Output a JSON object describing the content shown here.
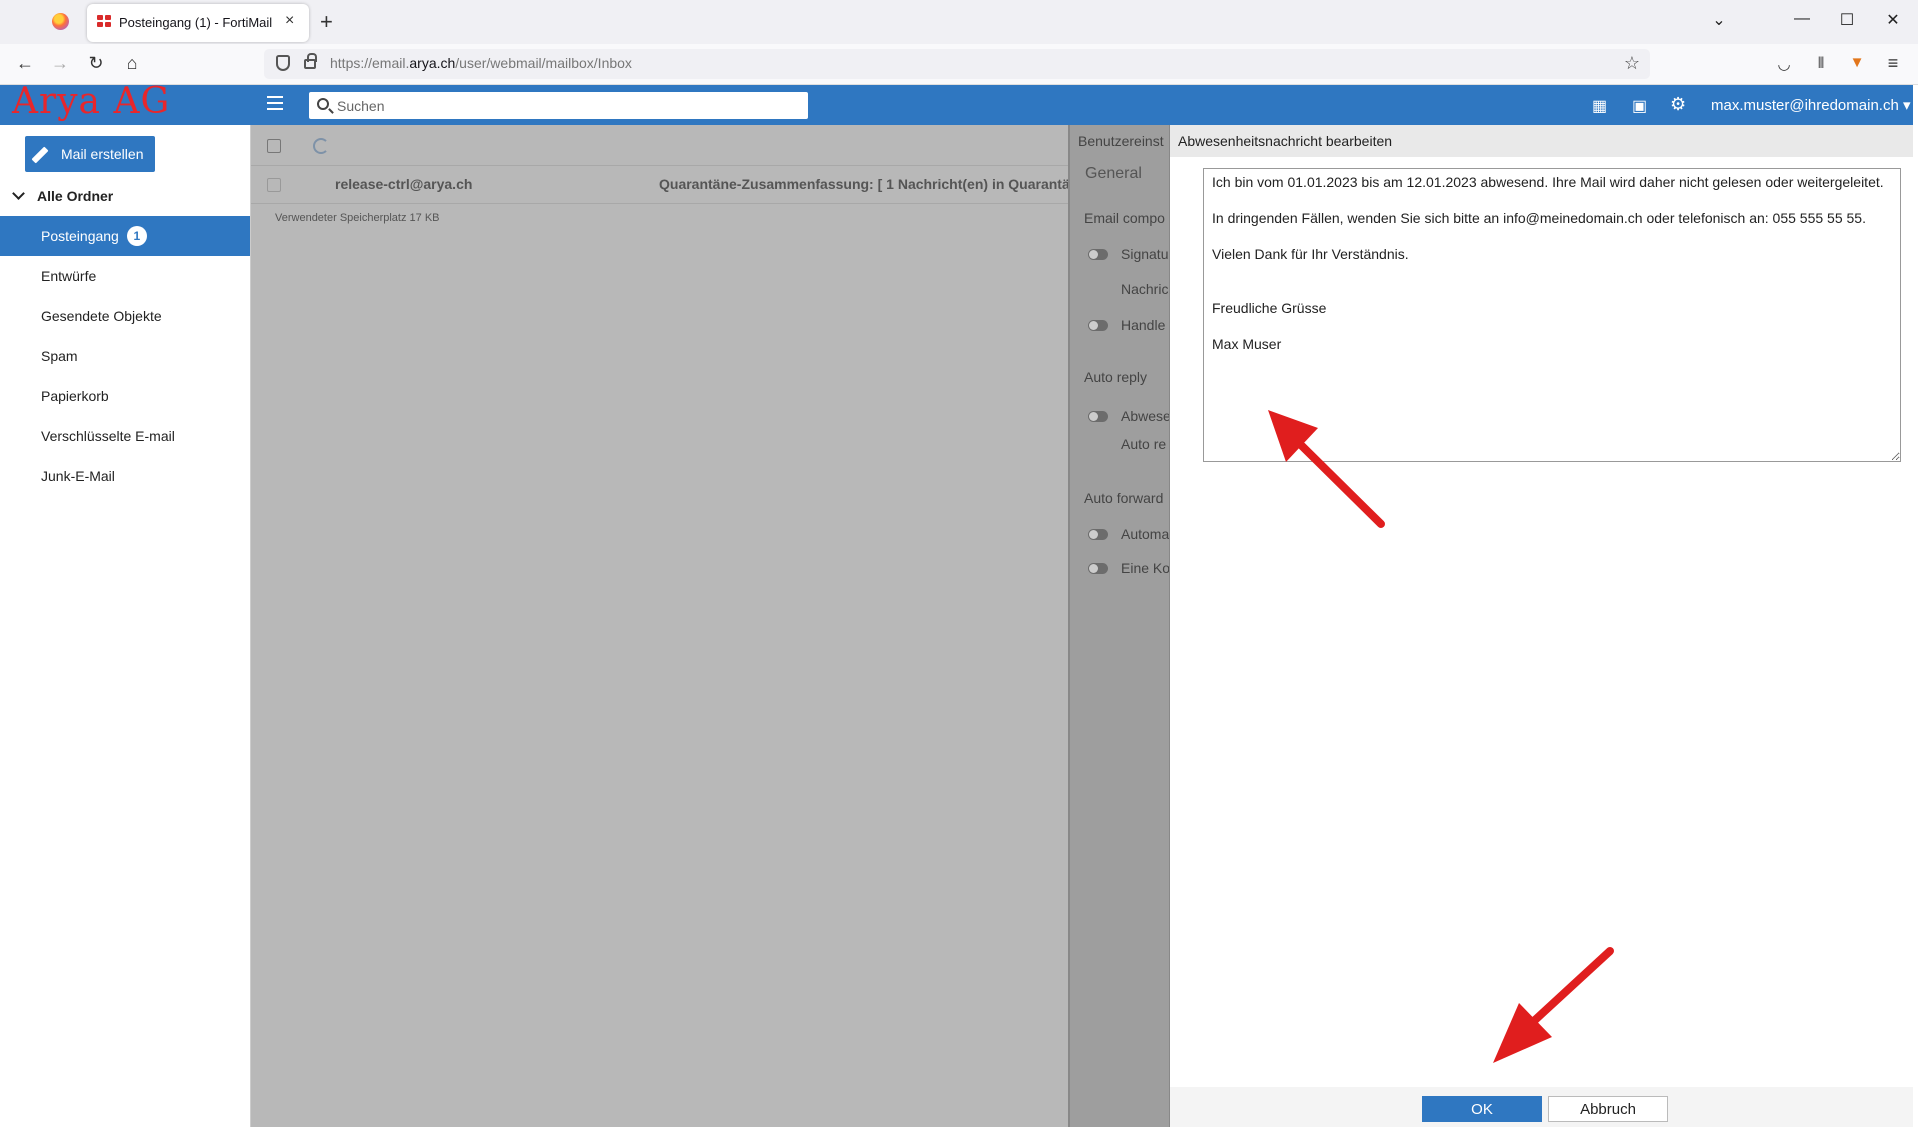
{
  "browser": {
    "tab_title": "Posteingang (1) - FortiMail",
    "tab_close": "×",
    "new_tab": "+",
    "url_prefix": "https://email.",
    "url_domain": "arya.ch",
    "url_path": "/user/webmail/mailbox/Inbox"
  },
  "header": {
    "logo_text": "Arya AG",
    "search_placeholder": "Suchen",
    "user_email": "max.muster@ihredomain.ch ▾"
  },
  "sidebar": {
    "compose_label": "Mail erstellen",
    "all_folders_label": "Alle Ordner",
    "folders": [
      {
        "label": "Posteingang",
        "badge": "1"
      },
      {
        "label": "Entwürfe"
      },
      {
        "label": "Gesendete Objekte"
      },
      {
        "label": "Spam"
      },
      {
        "label": "Papierkorb"
      },
      {
        "label": "Verschlüsselte E-mail"
      },
      {
        "label": "Junk-E-Mail"
      }
    ]
  },
  "mail_list": {
    "rows": [
      {
        "from": "release-ctrl@arya.ch",
        "subject": "Quarantäne-Zusammenfassung: [ 1 Nachricht(en) in Quarantäne v"
      }
    ],
    "storage_text": "Verwendeter Speicherplatz 17 KB"
  },
  "settings": {
    "title": "Benutzereinst",
    "tab_general": "General",
    "section_email_compose": "Email compo",
    "opt_signature": "Signatu",
    "opt_nachricht": "Nachric",
    "opt_handle": "Handle",
    "section_auto_reply": "Auto reply",
    "opt_abwesend": "Abwese",
    "opt_auto_reply": "Auto re",
    "section_auto_forward": "Auto forward",
    "opt_automatic": "Automa",
    "opt_eine_kopie": "Eine Ko"
  },
  "modal": {
    "title": "Abwesenheitsnachricht bearbeiten",
    "message": "Ich bin vom 01.01.2023 bis am 12.01.2023 abwesend. Ihre Mail wird daher nicht gelesen oder weitergeleitet.\n\nIn dringenden Fällen, wenden Sie sich bitte an info@meinedomain.ch oder telefonisch an: 055 555 55 55.\n\nVielen Dank für Ihr Verständnis.\n\n\nFreudliche Grüsse\n\nMax Muser",
    "ok_label": "OK",
    "cancel_label": "Abbruch"
  },
  "colors": {
    "brand_blue": "#2f77c1",
    "logo_red": "#e8262b",
    "annotation_red": "#e01e1e"
  }
}
